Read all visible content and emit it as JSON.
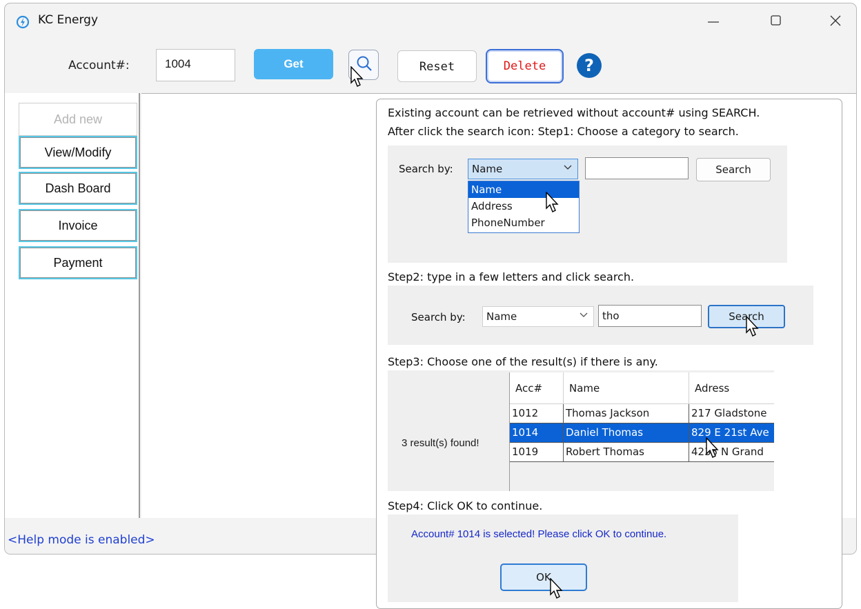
{
  "window": {
    "title": "KC Energy",
    "controls": {
      "minimize": "minimize-icon",
      "maximize": "maximize-icon",
      "close": "close-icon"
    }
  },
  "toolbar": {
    "account_label": "Account#:",
    "account_value": "1004",
    "get_label": "Get",
    "reset_label": "Reset",
    "delete_label": "Delete",
    "help_label": "?"
  },
  "sidebar": {
    "items": [
      {
        "label": "Add new",
        "enabled": false
      },
      {
        "label": "View/Modify",
        "enabled": true
      },
      {
        "label": "Dash Board",
        "enabled": true
      },
      {
        "label": "Invoice",
        "enabled": true
      },
      {
        "label": "Payment",
        "enabled": true
      }
    ]
  },
  "status_bar": {
    "text": "<Help mode is enabled>"
  },
  "help": {
    "intro_line1": "Existing account can be retrieved without account# using SEARCH.",
    "intro_line2": "After click the search icon: Step1: Choose a category to search.",
    "step1": {
      "search_by_label": "Search by:",
      "combo_value": "Name",
      "text_value": "",
      "search_button": "Search",
      "options": [
        "Name",
        "Address",
        "PhoneNumber"
      ],
      "selected_option": "Name"
    },
    "step2_text": "Step2: type in a few letters and click search.",
    "step2": {
      "search_by_label": "Search by:",
      "combo_value": "Name",
      "text_value": "tho",
      "search_button": "Search"
    },
    "step3_text": "Step3: Choose one of the result(s) if there is any.",
    "step3": {
      "result_count": "3 result(s) found!",
      "columns": [
        "Acc#",
        "Name",
        "Adress"
      ],
      "rows": [
        {
          "acc": "1012",
          "name": "Thomas Jackson",
          "address": "217 Gladstone"
        },
        {
          "acc": "1014",
          "name": "Daniel Thomas",
          "address": "829 E 21st Ave"
        },
        {
          "acc": "1019",
          "name": "Robert Thomas",
          "address": "4235 N Grand"
        }
      ],
      "selected_row": 1
    },
    "step4_text": "Step4: Click OK to continue.",
    "step4": {
      "message": "Account# 1014 is selected! Please click OK to continue.",
      "ok_label": "OK"
    }
  },
  "colors": {
    "get_button": "#4cb4f2",
    "delete_text": "#e01717",
    "help_button": "#0f63b6",
    "status_text": "#1f3fd1",
    "selection": "#0a62d6",
    "nav_border": "#58c8e6"
  }
}
